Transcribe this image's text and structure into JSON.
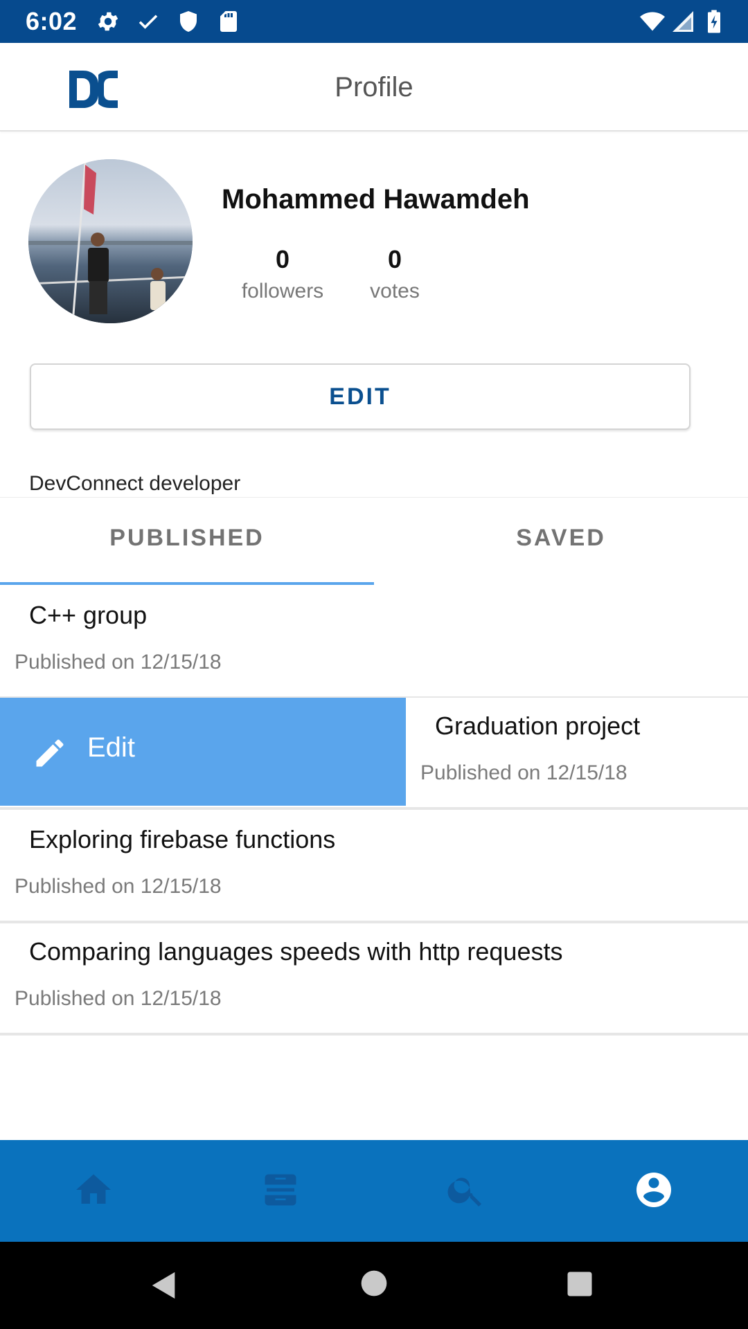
{
  "status_bar": {
    "time": "6:02",
    "icons": [
      "gear-icon",
      "check-icon",
      "shield-icon",
      "sd-card-icon",
      "wifi-icon",
      "signal-icon",
      "battery-charging-icon"
    ],
    "background": "#064a8e"
  },
  "app_bar": {
    "title": "Profile",
    "logo": "DC"
  },
  "profile": {
    "name": "Mohammed Hawamdeh",
    "followers_count": "0",
    "followers_label": "followers",
    "votes_count": "0",
    "votes_label": "votes",
    "edit_label": "EDIT",
    "bio": "DevConnect developer"
  },
  "tabs": [
    {
      "label": "PUBLISHED",
      "selected": true
    },
    {
      "label": "SAVED",
      "selected": false
    }
  ],
  "posts": [
    {
      "title": "C++ group",
      "date": "Published on 12/15/18"
    },
    {
      "title": "Graduation project",
      "date": "Published on 12/15/18",
      "swipe_action": "Edit"
    },
    {
      "title": "Exploring firebase functions",
      "date": "Published on 12/15/18"
    },
    {
      "title": "Comparing languages speeds with http requests",
      "date": "Published on 12/15/18"
    }
  ],
  "bottom_nav": {
    "items": [
      "home-icon",
      "inbox-icon",
      "search-icon",
      "account-icon"
    ],
    "selected": "account-icon",
    "background": "#0a72bd"
  },
  "colors": {
    "accent": "#5aa5ec",
    "brand": "#0a4f8f"
  }
}
